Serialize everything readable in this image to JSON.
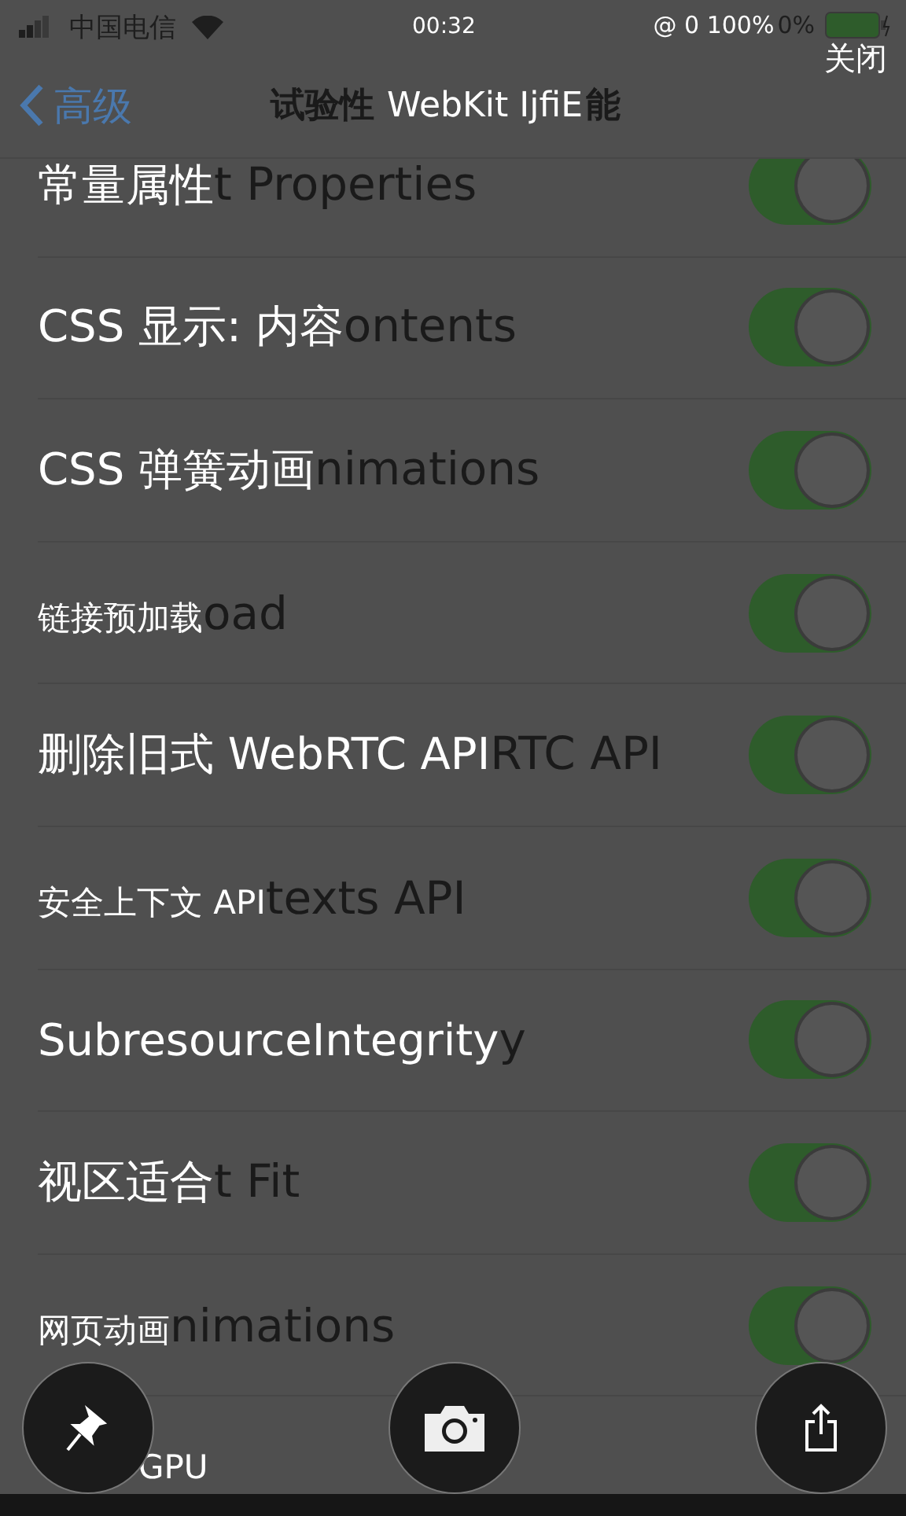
{
  "status_bar": {
    "carrier": "中国电信",
    "time": "00:32",
    "battery_overlay": "@ 0 100%",
    "battery_text": "0%"
  },
  "close_button": "关闭",
  "nav": {
    "back": "高级",
    "title_before": "试验性",
    "title_overlay": "WebKit IjfiE",
    "title_after": "能"
  },
  "rows": [
    {
      "translation": "常量属性",
      "remainder": "t Properties",
      "on": true,
      "large": true
    },
    {
      "translation": "CSS 显示: 内容",
      "remainder": "ontents",
      "on": true,
      "large": true
    },
    {
      "translation": "CSS 弹簧动画",
      "remainder": "nimations",
      "on": true,
      "large": true
    },
    {
      "translation": "链接预加载",
      "remainder": "oad",
      "on": true,
      "large": false
    },
    {
      "translation": "删除旧式 WebRTC API",
      "remainder": "RTC API",
      "on": true,
      "large": true
    },
    {
      "translation": "安全上下文 API",
      "remainder": "texts API",
      "on": true,
      "large": false
    },
    {
      "translation": "SubresourceIntegrity",
      "remainder": "y",
      "on": true,
      "large": true
    },
    {
      "translation": "视区适合",
      "remainder": "t Fit",
      "on": true,
      "large": true
    },
    {
      "translation": "网页动画",
      "remainder": "nimations",
      "on": true,
      "large": false
    },
    {
      "translation": "GPU",
      "large": false
    }
  ],
  "toolbar": [
    {
      "kind": "pin"
    },
    {
      "kind": "camera"
    },
    {
      "kind": "share"
    }
  ]
}
